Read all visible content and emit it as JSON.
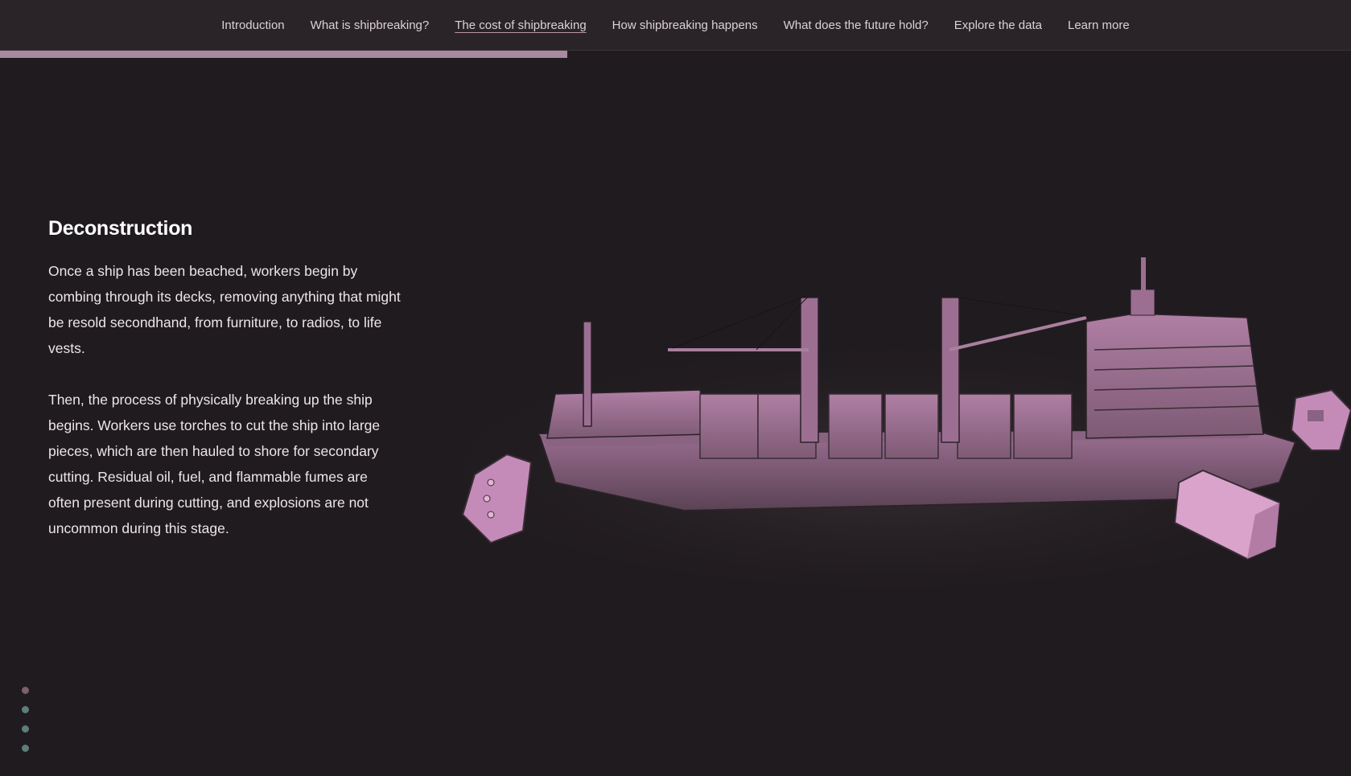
{
  "nav": {
    "items": [
      {
        "label": "Introduction",
        "active": false
      },
      {
        "label": "What is shipbreaking?",
        "active": false
      },
      {
        "label": "The cost of shipbreaking",
        "active": true
      },
      {
        "label": "How shipbreaking happens",
        "active": false
      },
      {
        "label": "What does the future hold?",
        "active": false
      },
      {
        "label": "Explore the data",
        "active": false
      },
      {
        "label": "Learn more",
        "active": false
      }
    ]
  },
  "progress": {
    "fraction": 0.42,
    "color": "#a98a9e"
  },
  "section": {
    "heading": "Deconstruction",
    "paragraphs": [
      "Once a ship has been beached, workers begin by combing through its decks, removing anything that might be resold secondhand, from furniture, to radios, to life vests.",
      "Then, the process of physically breaking up the ship begins. Workers use torches to cut the ship into large pieces, which are then hauled to shore for secondary cutting. Residual oil, fuel, and flammable fumes are often present during cutting, and explosions are not uncommon during this stage."
    ]
  },
  "illustration": {
    "icon": "cargo-ship-being-dismantled-illustration",
    "accent": "#c48bb8"
  },
  "step_dots": {
    "count": 4,
    "active_index": 0,
    "active_color": "#7d5f6e",
    "inactive_color": "#5f7d79"
  }
}
